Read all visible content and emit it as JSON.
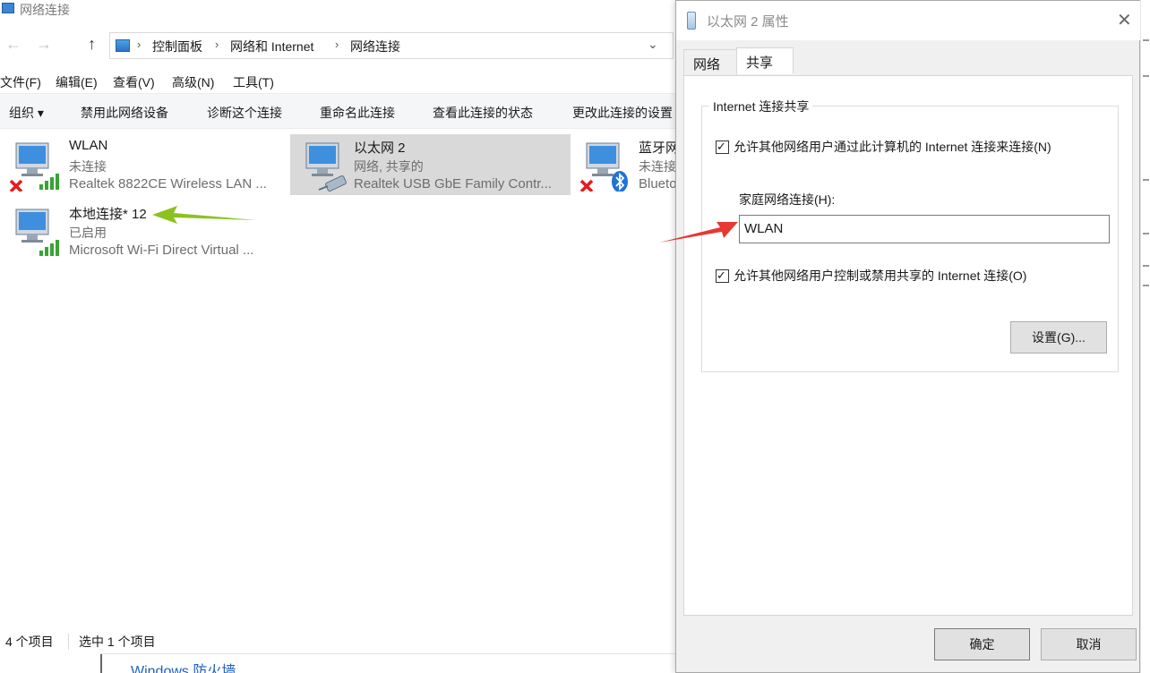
{
  "explorer": {
    "title": "网络连接",
    "nav": {
      "back": "←",
      "forward": "→",
      "up": "↑",
      "chevron": "›",
      "dropdown": "⌄"
    },
    "breadcrumb": [
      "控制面板",
      "网络和 Internet",
      "网络连接"
    ],
    "menu": [
      "文件(F)",
      "编辑(E)",
      "查看(V)",
      "高级(N)",
      "工具(T)"
    ],
    "commands": {
      "organize": "组织 ▾",
      "disable": "禁用此网络设备",
      "diagnose": "诊断这个连接",
      "rename": "重命名此连接",
      "view_status": "查看此连接的状态",
      "change_settings": "更改此连接的设置"
    },
    "connections": [
      {
        "name": "WLAN",
        "status": "未连接",
        "device": "Realtek 8822CE Wireless LAN ...",
        "overlay": "red-x-icon"
      },
      {
        "name": "以太网 2",
        "status": "网络, 共享的",
        "device": "Realtek USB GbE Family Contr...",
        "selected": true,
        "overlay": "cable-icon"
      },
      {
        "name": "蓝牙网",
        "status": "未连接",
        "device": "Blueto",
        "overlay": "bluetooth-icon"
      },
      {
        "name": "本地连接* 12",
        "status": "已启用",
        "device": "Microsoft Wi-Fi Direct Virtual ...",
        "overlay": "signal-bars-icon"
      }
    ],
    "statusbar": {
      "count": "4 个项目",
      "selected": "选中 1 个项目"
    },
    "behind_link": "Windows 防火墙"
  },
  "dialog": {
    "title": "以太网 2 属性",
    "tabs": [
      "网络",
      "共享"
    ],
    "active_tab": "共享",
    "group_label": "Internet 连接共享",
    "allow_share": {
      "label": "允许其他网络用户通过此计算机的 Internet 连接来连接(N)",
      "checked": true
    },
    "home_label": "家庭网络连接(H):",
    "home_value": "WLAN",
    "allow_control": {
      "label": "允许其他网络用户控制或禁用共享的 Internet 连接(O)",
      "checked": true
    },
    "settings_button": "设置(G)...",
    "ok_button": "确定",
    "cancel_button": "取消",
    "close": "✕",
    "check_mark": "✓"
  },
  "annotations": {
    "green_arrow_color": "#8cc21f",
    "red_arrow_color": "#e53935"
  }
}
